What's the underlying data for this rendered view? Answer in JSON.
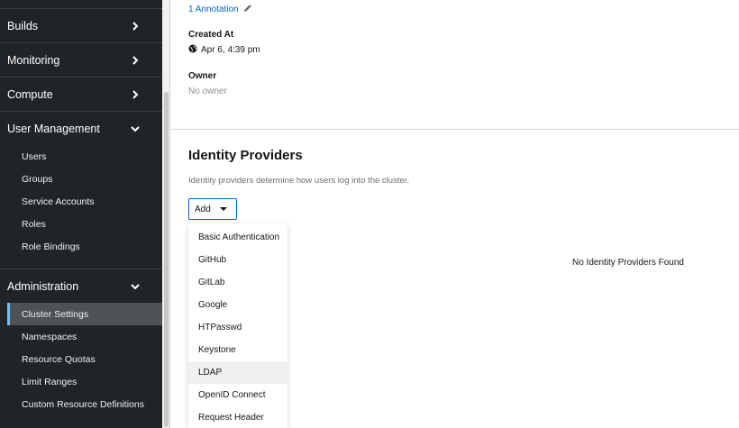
{
  "sidebar": {
    "sections": [
      {
        "label": "Builds",
        "expanded": false
      },
      {
        "label": "Monitoring",
        "expanded": false
      },
      {
        "label": "Compute",
        "expanded": false
      },
      {
        "label": "User Management",
        "expanded": true
      },
      {
        "label": "Administration",
        "expanded": true
      }
    ],
    "user_management_items": [
      "Users",
      "Groups",
      "Service Accounts",
      "Roles",
      "Role Bindings"
    ],
    "administration_items": [
      "Cluster Settings",
      "Namespaces",
      "Resource Quotas",
      "Limit Ranges",
      "Custom Resource Definitions"
    ],
    "active_item": "Cluster Settings"
  },
  "details": {
    "annotations_link": "1 Annotation",
    "created_at_label": "Created At",
    "created_at_value": "Apr 6, 4:39 pm",
    "owner_label": "Owner",
    "owner_value": "No owner"
  },
  "identity_providers": {
    "title": "Identity Providers",
    "description": "Identity providers determine how users log into the cluster.",
    "add_label": "Add",
    "empty_message": "No Identity Providers Found",
    "dropdown_items": [
      "Basic Authentication",
      "GitHub",
      "GitLab",
      "Google",
      "HTPasswd",
      "Keystone",
      "LDAP",
      "OpenID Connect",
      "Request Header"
    ],
    "hovered_item": "LDAP"
  },
  "colors": {
    "sidebar_bg": "#212427",
    "active_accent": "#73bcf7",
    "link": "#0066cc"
  }
}
